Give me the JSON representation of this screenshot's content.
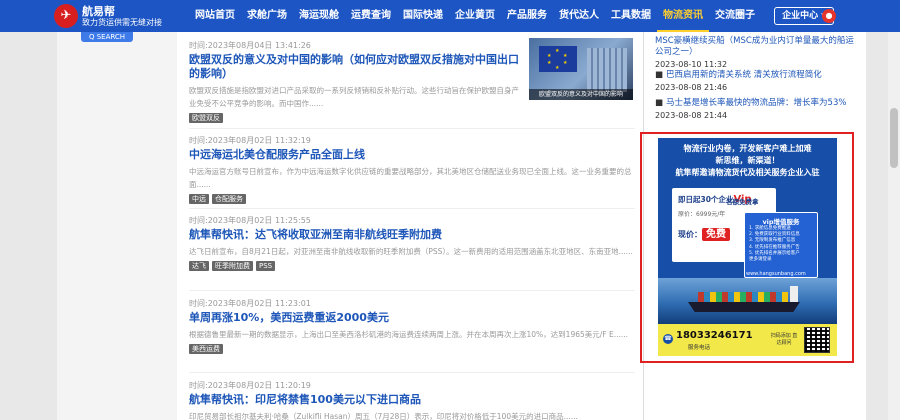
{
  "header": {
    "logo_mark": "✈",
    "logo_name": "航易帮",
    "logo_slogan": "致力货运供需无缝对接",
    "nav": [
      "网站首页",
      "求舱广场",
      "海运现舱",
      "运费查询",
      "国际快递",
      "企业黄页",
      "产品服务",
      "货代达人",
      "工具数据",
      "物流资讯",
      "交流圈子"
    ],
    "active_nav": "物流资讯",
    "enterprise_center": "企业中心",
    "user_icon": "user-icon"
  },
  "left": {
    "button_label": "Q SEARCH"
  },
  "articles": [
    {
      "time": "时间:2023年08月04日 13:41:26",
      "title": "欧盟双反的意义及对中国的影响（如何应对欧盟双反措施对中国出口的影响）",
      "summary": "欧盟双反措施是指欧盟对进口产品采取的一系列反倾销和反补贴行动。这些行动旨在保护欧盟自身产业免受不公平竞争的影响。而中国作......",
      "tags": [
        "欧盟双反"
      ],
      "image_caption": "欧盟双反的意义及对中国的影响"
    },
    {
      "time": "时间:2023年08月02日 11:32:19",
      "title": "中远海运北美仓配服务产品全面上线",
      "summary": "中远海运官方账号日前宣布，作为中远海运数字化供应链的重要战略部分，其北美地区仓储配送业务现已全面上线。这一业务重要的总面......",
      "tags": [
        "中远",
        "仓配服务"
      ]
    },
    {
      "time": "时间:2023年08月02日 11:25:55",
      "title": "航隼帮快讯：达飞将收取亚洲至南非航线旺季附加费",
      "summary": "达飞日前宣布，自8月21日起，对亚洲至南非航线收取新的旺季附加费（PSS）。这一新费用的适用范围涵盖东北亚地区、东南亚地......",
      "tags": [
        "达飞",
        "旺季附加费",
        "PSS"
      ]
    },
    {
      "time": "时间:2023年08月02日 11:23:01",
      "title": "单周再涨10%，美西运费重返2000美元",
      "summary": "根据德鲁里最新一期的数据显示，上海出口至美西洛杉矶港的海运费连续两周上涨。并在本周再次上涨10%，达到1965美元/F E......",
      "tags": [
        "美西运费"
      ]
    },
    {
      "time": "时间:2023年08月02日 11:20:19",
      "title": "航隼帮快讯：印尼将禁售100美元以下进口商品",
      "summary": "印尼贸易部长祖尔基夫利·哈桑（Zulkifli Hasan）周五（7月28日）表示，印尼将对价格低于100美元的进口商品......",
      "tags": []
    }
  ],
  "sidebar": {
    "news": [
      {
        "title": "MSC豪横继续买船（MSC成为业内订单量最大的船运公司之一）",
        "date": "2023-08-10 11:32",
        "bullet": false
      },
      {
        "title": "巴西启用新的清关系统 清关放行流程简化",
        "date": "2023-08-08 21:46",
        "bullet": true
      },
      {
        "title": "马士基是增长率最快的物流品牌：增长率为53%",
        "date": "2023-08-08 21:44",
        "bullet": true
      }
    ],
    "ad": {
      "line1": "物流行业内卷，开发新客户难上加难",
      "line2": "新思维，新渠道！",
      "line3": "航隼帮邀请物流货代及相关服务企业入驻",
      "card_line1": "即日起30个企业",
      "card_vip": "Vip",
      "card_line1b": "名额免费拿",
      "card_original": "原价：6999元/年",
      "card_now": "现价：",
      "card_free": "免费",
      "vip_head": "vip增值服务",
      "vip_items": [
        "1. 求舱信息免费推送",
        "2. 免费获取行业资料信息",
        "3. 无限制发布推广信息",
        "4. 优先排在推荐服务广告",
        "5. 优先排名并展示给客户",
        "更多请登录"
      ],
      "url": "www.hangsunbang.com",
      "phone": "18033246171",
      "phone_label": "服务电话",
      "contact": "扫码添加 直达顾问"
    }
  }
}
